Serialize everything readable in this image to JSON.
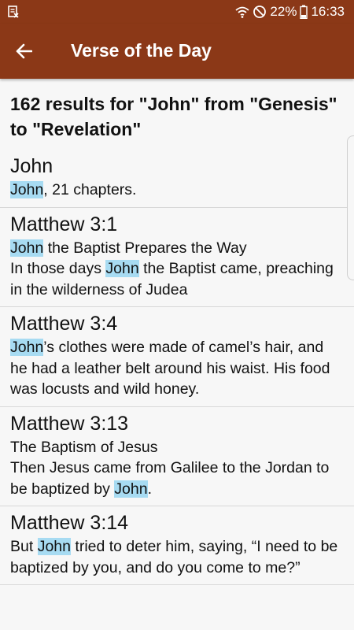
{
  "status": {
    "battery": "22%",
    "time": "16:33"
  },
  "appbar": {
    "title": "Verse of the Day"
  },
  "summary": "162 results for \"John\" from \"Genesis\" to \"Revelation\"",
  "results": [
    {
      "ref": "John",
      "body": [
        [
          {
            "t": "John",
            "h": true
          },
          {
            "t": ", 21 chapters."
          }
        ]
      ]
    },
    {
      "ref": "Matthew 3:1",
      "body": [
        [
          {
            "t": "John",
            "h": true
          },
          {
            "t": " the Baptist Prepares the Way"
          }
        ],
        [
          {
            "t": "In those days "
          },
          {
            "t": "John",
            "h": true
          },
          {
            "t": " the Baptist came, preaching in the wilderness of Judea"
          }
        ]
      ]
    },
    {
      "ref": "Matthew 3:4",
      "body": [
        [
          {
            "t": "John",
            "h": true
          },
          {
            "t": "’s clothes were made of camel’s hair, and he had a leather belt around his waist. His food was locusts and wild honey."
          }
        ]
      ]
    },
    {
      "ref": "Matthew 3:13",
      "body": [
        [
          {
            "t": "The Baptism of Jesus"
          }
        ],
        [
          {
            "t": "Then Jesus came from Galilee to the Jordan to be baptized by "
          },
          {
            "t": "John",
            "h": true
          },
          {
            "t": "."
          }
        ]
      ]
    },
    {
      "ref": "Matthew 3:14",
      "body": [
        [
          {
            "t": "But "
          },
          {
            "t": "John",
            "h": true
          },
          {
            "t": " tried to deter him, saying, “I need to be baptized by you, and do you come to me?”"
          }
        ]
      ]
    }
  ]
}
